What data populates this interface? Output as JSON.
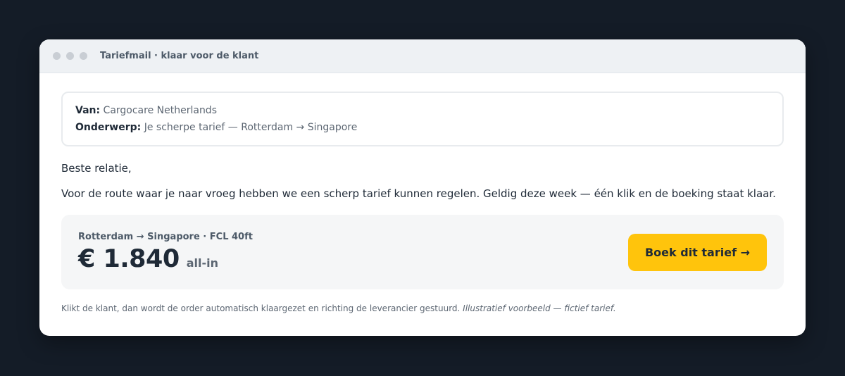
{
  "window": {
    "title": "Tariefmail · klaar voor de klant"
  },
  "email": {
    "from_label": "Van:",
    "from_value": "Cargocare Netherlands",
    "subject_label": "Onderwerp:",
    "subject_value": "Je scherpe tarief — Rotterdam → Singapore",
    "greeting": "Beste relatie,",
    "body": "Voor de route waar je naar vroeg hebben we een scherp tarief kunnen regelen. Geldig deze week — één klik en de boeking staat klaar."
  },
  "rate": {
    "route": "Rotterdam → Singapore · FCL 40ft",
    "price": "€ 1.840",
    "price_suffix": "all-in",
    "cta_label": "Boek dit tarief →"
  },
  "footnote": {
    "text": "Klikt de klant, dan wordt de order automatisch klaargezet en richting de leverancier gestuurd.",
    "disclaimer": "Illustratief voorbeeld — fictief tarief."
  },
  "colors": {
    "background": "#141c27",
    "accent": "#ffc40c",
    "text": "#1f2a37"
  }
}
